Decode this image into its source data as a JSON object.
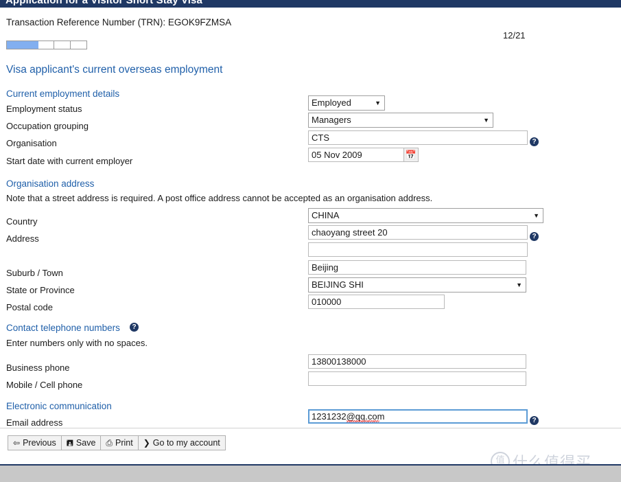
{
  "header": {
    "title": "Application for a Visitor Short Stay Visa",
    "bar_color": "#1f3864"
  },
  "trn": {
    "text": "Transaction Reference Number (TRN): EGOK9FZMSA"
  },
  "progress": {
    "page_counter": "12/21",
    "segments_total": 5,
    "segments_filled": 2,
    "fill_color": "#82aff0"
  },
  "section_title": "Visa applicant's current overseas employment",
  "employment": {
    "heading": "Current employment details",
    "status_label": "Employment status",
    "status_value": "Employed",
    "occupation_label": "Occupation grouping",
    "occupation_value": "Managers",
    "organisation_label": "Organisation",
    "organisation_value": "CTS",
    "start_date_label": "Start date with current employer",
    "start_date_value": "05 Nov 2009",
    "calendar_icon": "calendar-icon"
  },
  "address": {
    "heading": "Organisation address",
    "note": "Note that a street address is required. A post office address cannot be accepted as an organisation address.",
    "country_label": "Country",
    "country_value": "CHINA",
    "address_label": "Address",
    "address_line1": "chaoyang street 20",
    "address_line2": "",
    "suburb_label": "Suburb / Town",
    "suburb_value": "Beijing",
    "state_label": "State or Province",
    "state_value": "BEIJING SHI",
    "postal_label": "Postal code",
    "postal_value": "010000"
  },
  "telephone": {
    "heading": "Contact telephone numbers",
    "note": "Enter numbers only with no spaces.",
    "business_label": "Business phone",
    "business_value": "13800138000",
    "mobile_label": "Mobile / Cell phone",
    "mobile_value": ""
  },
  "electronic": {
    "heading": "Electronic communication",
    "email_label": "Email address",
    "email_value": "1231232@qq.com"
  },
  "help_icon_glyph": "?",
  "caret_glyph": "▼",
  "toolbar": {
    "previous_icon": "⇦",
    "previous_label": "Previous",
    "save_icon": "὚b",
    "save_label": "Save",
    "print_icon": "⎙",
    "print_label": "Print",
    "account_icon": "❯",
    "account_label": "Go to my account"
  },
  "watermark": {
    "logo_glyph": "值",
    "text": "什么值得买"
  }
}
